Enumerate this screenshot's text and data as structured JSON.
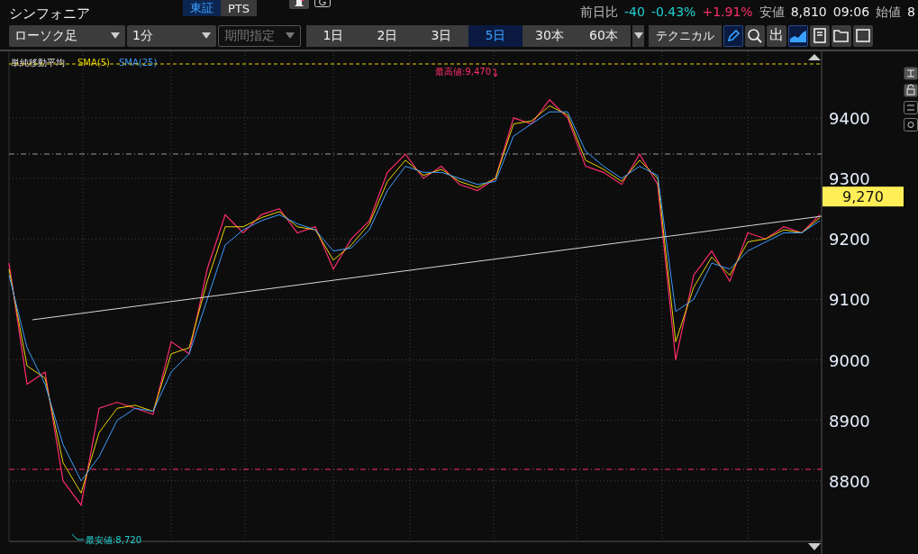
{
  "stock_name": "シンフォニア",
  "market_tabs": [
    {
      "label": "東証",
      "selected": true
    },
    {
      "label": "PTS",
      "selected": false
    }
  ],
  "quote": [
    {
      "kind": "label",
      "text": "前日比"
    },
    {
      "kind": "down",
      "text": "-40"
    },
    {
      "kind": "down",
      "text": "-0.43%"
    },
    {
      "kind": "up",
      "text": "+1.91%"
    },
    {
      "kind": "label",
      "text": "安値"
    },
    {
      "kind": "value",
      "text": "8,810"
    },
    {
      "kind": "value",
      "text": "09:06"
    },
    {
      "kind": "label",
      "text": "始値"
    },
    {
      "kind": "value",
      "text": "8"
    }
  ],
  "toolbar": {
    "dropdowns": [
      {
        "label": "ローソク足",
        "disabled": false
      },
      {
        "label": "1分",
        "disabled": false
      },
      {
        "label": "期間指定",
        "disabled": true
      }
    ],
    "ranges": [
      {
        "label": "1日",
        "selected": false
      },
      {
        "label": "2日",
        "selected": false
      },
      {
        "label": "3日",
        "selected": false
      },
      {
        "label": "5日",
        "selected": true
      },
      {
        "label": "30本",
        "selected": false
      },
      {
        "label": "60本",
        "selected": false
      }
    ],
    "technical": "テクニカル",
    "tools": [
      {
        "kind": "pencil",
        "selected": true
      },
      {
        "kind": "zoom",
        "selected": false
      },
      {
        "kind": "text",
        "label": "出",
        "selected": false
      },
      {
        "kind": "area",
        "selected": true
      },
      {
        "kind": "save",
        "selected": false
      },
      {
        "kind": "folder",
        "selected": false
      },
      {
        "kind": "window",
        "selected": false
      }
    ]
  },
  "chart": {
    "legend": "単純移動平均",
    "current_price": "9,270",
    "chart_data": {
      "type": "line",
      "grid": true,
      "ylim": [
        8700,
        9510
      ],
      "yticks": [
        8800,
        8900,
        9000,
        9100,
        9200,
        9300,
        9400
      ],
      "series": [
        {
          "color": "#ff2d6a",
          "values": [
            9160,
            8960,
            8980,
            8800,
            8760,
            8920,
            8930,
            8920,
            8910,
            9030,
            9010,
            9150,
            9240,
            9210,
            9240,
            9250,
            9210,
            9220,
            9150,
            9200,
            9230,
            9310,
            9340,
            9300,
            9320,
            9290,
            9280,
            9300,
            9400,
            9390,
            9430,
            9400,
            9320,
            9310,
            9290,
            9340,
            9290,
            9000,
            9140,
            9180,
            9130,
            9210,
            9200,
            9220,
            9210,
            9240
          ]
        },
        {
          "name": "SMA(5)",
          "color": "#e8d400",
          "values": [
            9150,
            8990,
            8970,
            8830,
            8780,
            8880,
            8920,
            8925,
            8915,
            9010,
            9020,
            9130,
            9220,
            9220,
            9235,
            9245,
            9220,
            9215,
            9165,
            9190,
            9225,
            9295,
            9330,
            9305,
            9315,
            9295,
            9285,
            9300,
            9390,
            9395,
            9420,
            9405,
            9330,
            9315,
            9295,
            9330,
            9300,
            9030,
            9120,
            9170,
            9140,
            9195,
            9200,
            9215,
            9210,
            9235
          ]
        },
        {
          "name": "SMA(25)",
          "color": "#3f9cff",
          "values": [
            9140,
            9020,
            8960,
            8860,
            8800,
            8840,
            8900,
            8920,
            8915,
            8980,
            9010,
            9100,
            9190,
            9215,
            9230,
            9240,
            9225,
            9215,
            9180,
            9185,
            9215,
            9280,
            9320,
            9310,
            9310,
            9300,
            9290,
            9295,
            9370,
            9390,
            9410,
            9410,
            9345,
            9320,
            9300,
            9320,
            9305,
            9080,
            9100,
            9160,
            9150,
            9180,
            9195,
            9210,
            9210,
            9230
          ]
        }
      ],
      "annotations": [
        {
          "text": "最高値:9,470"
        },
        {
          "text": "最安値:8,720"
        }
      ]
    }
  }
}
